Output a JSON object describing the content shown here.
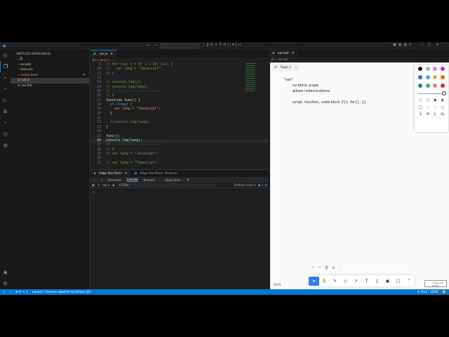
{
  "titlebar": {
    "nav_back": "←",
    "nav_fwd": "→"
  },
  "sidebar": {
    "title": "UNTITLED (WORKSPACE)",
    "root": "JS",
    "items": [
      {
        "label": "vscode",
        "kind": "folder"
      },
      {
        "label": "closures",
        "kind": "folder"
      },
      {
        "label": "index.html",
        "badge": "4"
      },
      {
        "label": "var.js"
      },
      {
        "label": "var.tldr"
      }
    ]
  },
  "editor": {
    "tab": "var.js",
    "breadcrumb": "JS > var.js > ...",
    "active_line": 26,
    "lines": [
      {
        "n": 9,
        "t": "// for (var i = 0; i < 10; i++) {",
        "c": "cm"
      },
      {
        "n": 10,
        "t": "//   var lang = \"Javascipt\";",
        "c": "cm"
      },
      {
        "n": 11,
        "t": "// }",
        "c": "cm"
      },
      {
        "n": 12,
        "t": "",
        "c": ""
      },
      {
        "n": 13,
        "t": "// console.log(i);",
        "c": "cm"
      },
      {
        "n": 14,
        "t": "// console.log(lang);",
        "c": "cm"
      },
      {
        "n": 15,
        "t": "//--------------------------",
        "c": "cm"
      },
      {
        "n": 16,
        "t": "// 3",
        "c": "cm"
      },
      {
        "n": 17,
        "t": "function func() {",
        "c": "fn"
      },
      {
        "n": 18,
        "t": "  if (true) {",
        "c": "kw"
      },
      {
        "n": 19,
        "t": "    var lang = \"Javascipt\";",
        "c": "st"
      },
      {
        "n": 20,
        "t": "  }",
        "c": ""
      },
      {
        "n": 21,
        "t": "",
        "c": ""
      },
      {
        "n": 22,
        "t": "  //console.log(lang);",
        "c": "cm"
      },
      {
        "n": 23,
        "t": "}",
        "c": ""
      },
      {
        "n": 24,
        "t": "",
        "c": ""
      },
      {
        "n": 25,
        "t": "func();",
        "c": "fn"
      },
      {
        "n": 26,
        "t": "console.log(lang);",
        "c": "vr"
      },
      {
        "n": 27,
        "t": "//--------------------------",
        "c": "cm"
      },
      {
        "n": 28,
        "t": "// 4",
        "c": "cm"
      },
      {
        "n": 29,
        "t": "// var lang = \"Javascipt\";",
        "c": "cm"
      },
      {
        "n": 30,
        "t": "",
        "c": ""
      },
      {
        "n": 31,
        "t": "// var lang = \"Typescipt\";",
        "c": "cm"
      }
    ]
  },
  "devtools": {
    "tabs": [
      "Edge DevTools",
      "Edge DevTools: Browser"
    ],
    "panels": [
      "Elements",
      "Console",
      "Network",
      "Application"
    ],
    "active_panel": "Console",
    "context": "top",
    "filter_placeholder": "Filter",
    "levels": "Default levels",
    "issues": "6",
    "prompt": ">"
  },
  "right": {
    "tab": "var.tldr",
    "breadcrumb": "JS > var.tldr",
    "page": "Page 1",
    "zoom": "100%",
    "notes": [
      "\"var\"",
      "no block scope",
      "allows redeclarations",
      "script, function, code-block if{}, for{}, {}"
    ],
    "colors": [
      "#1d1d1d",
      "#adb5bd",
      "#e085f4",
      "#ae3ec9",
      "#4465e9",
      "#4ba1f1",
      "#f1ac4b",
      "#e16919",
      "#099268",
      "#4cb05e",
      "#f87777",
      "#e03131"
    ],
    "sizes": [
      "S",
      "M",
      "L",
      "XL"
    ],
    "made_with": "made with tldraw"
  },
  "status": {
    "errors": "0",
    "warnings": "1",
    "launch": "Launch Chrome against localhost (JS)",
    "port": "Port : 5500"
  }
}
